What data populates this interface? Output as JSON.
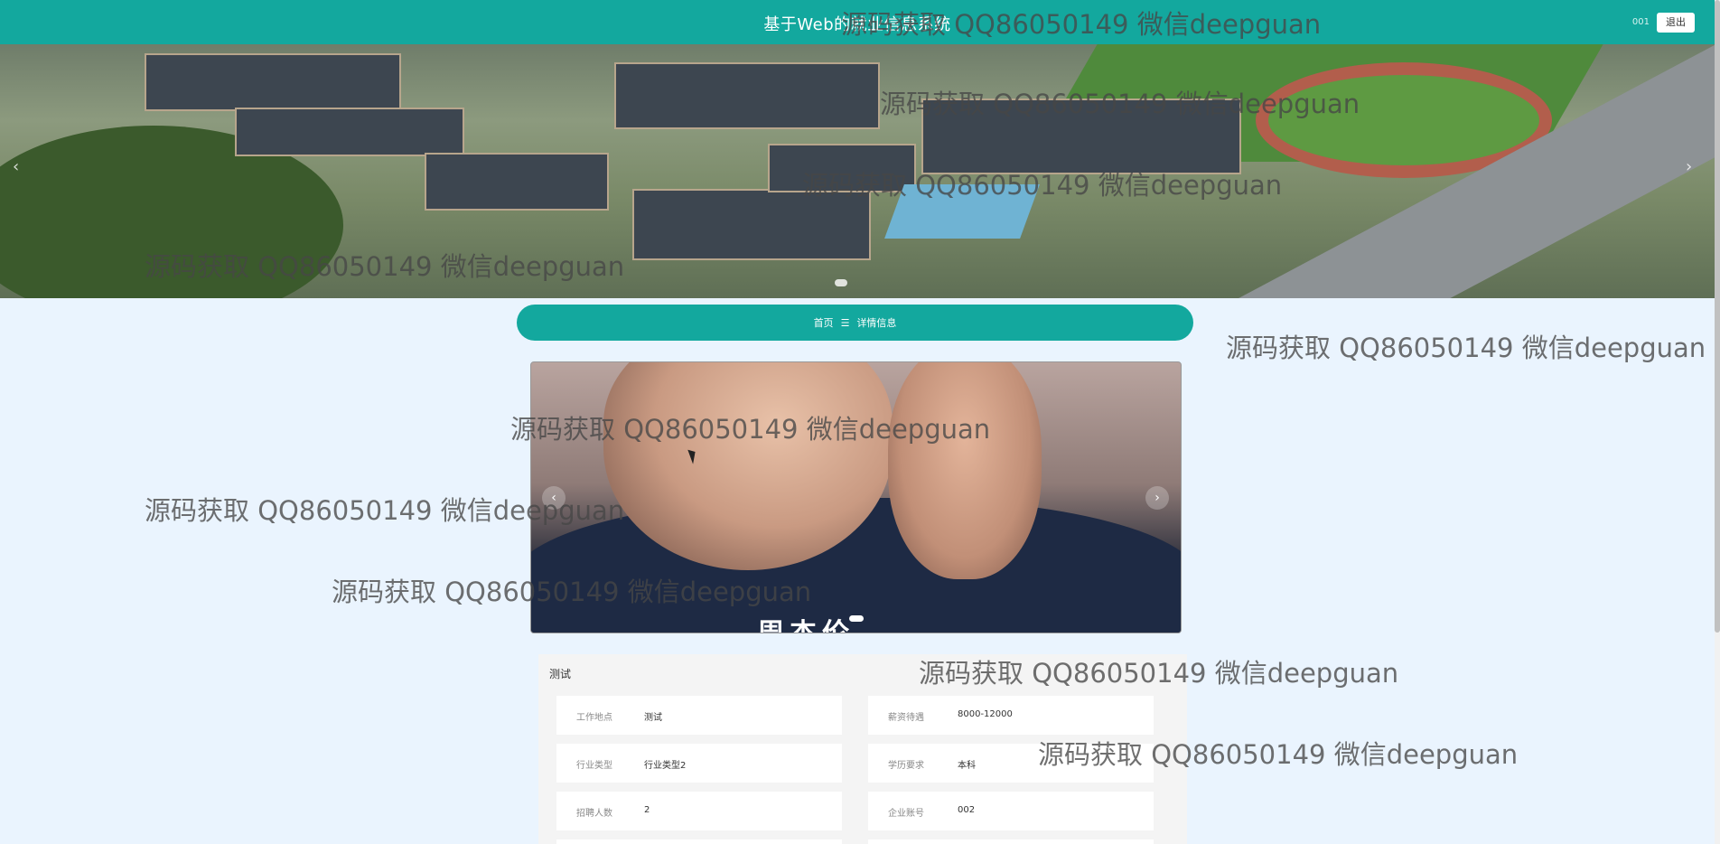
{
  "header": {
    "title": "基于Web的就业信息系统",
    "username": "001",
    "logout_label": "退出"
  },
  "banner": {
    "prev_glyph": "‹",
    "next_glyph": "›"
  },
  "breadcrumb": {
    "home": "首页",
    "separator": "☰",
    "current": "详情信息"
  },
  "carousel": {
    "caption": "周杰伦",
    "prev_glyph": "‹",
    "next_glyph": "›"
  },
  "detail": {
    "title": "测试",
    "fields": [
      {
        "label": "工作地点",
        "value": "测试"
      },
      {
        "label": "薪资待遇",
        "value": "8000-12000"
      },
      {
        "label": "行业类型",
        "value": "行业类型2"
      },
      {
        "label": "学历要求",
        "value": "本科"
      },
      {
        "label": "招聘人数",
        "value": "2"
      },
      {
        "label": "企业账号",
        "value": "002"
      }
    ]
  },
  "watermark": "源码获取 QQ86050149 微信deepguan"
}
